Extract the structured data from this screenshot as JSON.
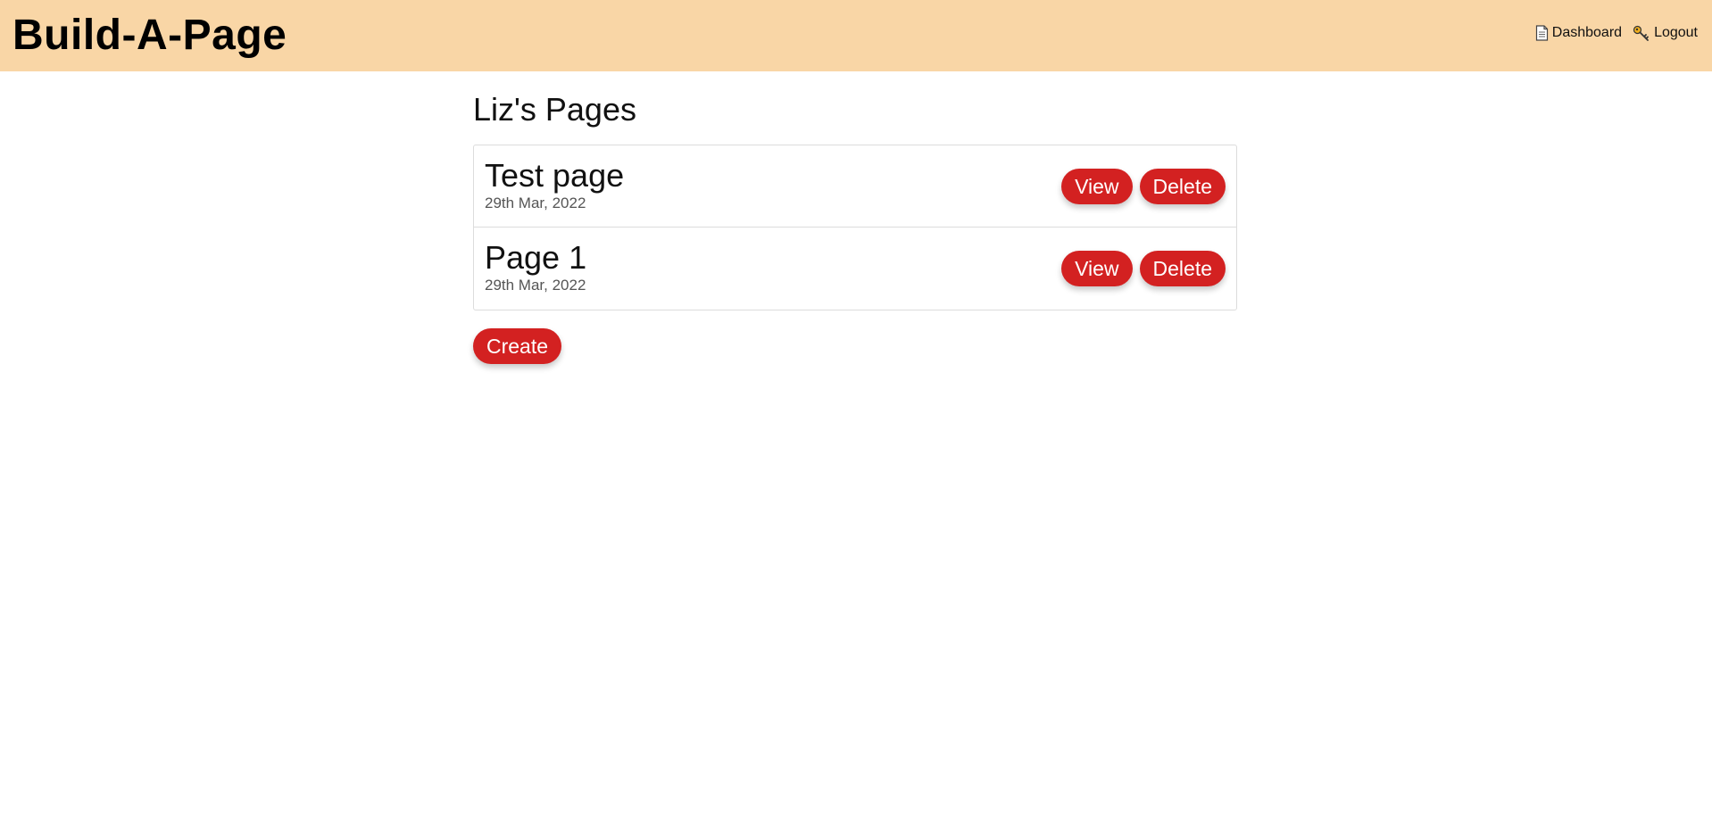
{
  "header": {
    "brand": "Build-A-Page",
    "nav": {
      "dashboard_label": "Dashboard",
      "dashboard_icon": "page-icon",
      "logout_label": "Logout",
      "logout_icon": "key-icon"
    }
  },
  "main": {
    "heading": "Liz's Pages",
    "pages": [
      {
        "title": "Test page",
        "date": "29th Mar, 2022",
        "view_label": "View",
        "delete_label": "Delete"
      },
      {
        "title": "Page 1",
        "date": "29th Mar, 2022",
        "view_label": "View",
        "delete_label": "Delete"
      }
    ],
    "create_label": "Create"
  },
  "colors": {
    "header_bg": "#f9d6a6",
    "button_red": "#d32121"
  }
}
